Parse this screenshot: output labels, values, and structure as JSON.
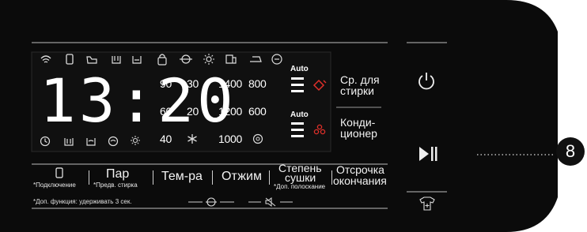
{
  "display": {
    "time": "13:20",
    "temps": [
      "90",
      "30",
      "60",
      "20",
      "40"
    ],
    "spins": [
      "1400",
      "800",
      "1200",
      "600",
      "1000"
    ],
    "dryer_auto": "Auto",
    "conditioner_auto": "Auto"
  },
  "side_labels": {
    "detergent_line1": "Ср. для",
    "detergent_line2": "стирки",
    "conditioner_line1": "Конди-",
    "conditioner_line2": "ционер"
  },
  "buttons": {
    "lock_sub": "*Подключение",
    "steam": "Пар",
    "steam_sub": "*Предв. стирка",
    "temp": "Тем-ра",
    "spin": "Отжим",
    "dry_line1": "Степень",
    "dry_line2": "сушки",
    "dry_sub": "*Доп. полоскание",
    "delay_line1": "Отсрочка",
    "delay_line2": "окончания"
  },
  "footer_note": "*Доп. функция: удерживать 3 сек.",
  "callout_number": "8",
  "icons": [
    "wifi-icon",
    "phone-icon",
    "hand-wash-icon",
    "basin-icon",
    "bucket-icon",
    "lock-icon",
    "drum-icon",
    "sun-icon",
    "pressure-icon",
    "iron-icon",
    "eco-icon",
    "clock-icon",
    "tub-icon",
    "soak-icon",
    "spin-icon",
    "sun-small-icon",
    "snowflake-icon",
    "no-spin-icon",
    "power-icon",
    "play-pause-icon",
    "shirt-icon",
    "tap-icon",
    "flower-icon"
  ],
  "colors": {
    "panel": "#0b0b0b",
    "accent_red": "#e0302a",
    "text": "#f2f2f2"
  }
}
